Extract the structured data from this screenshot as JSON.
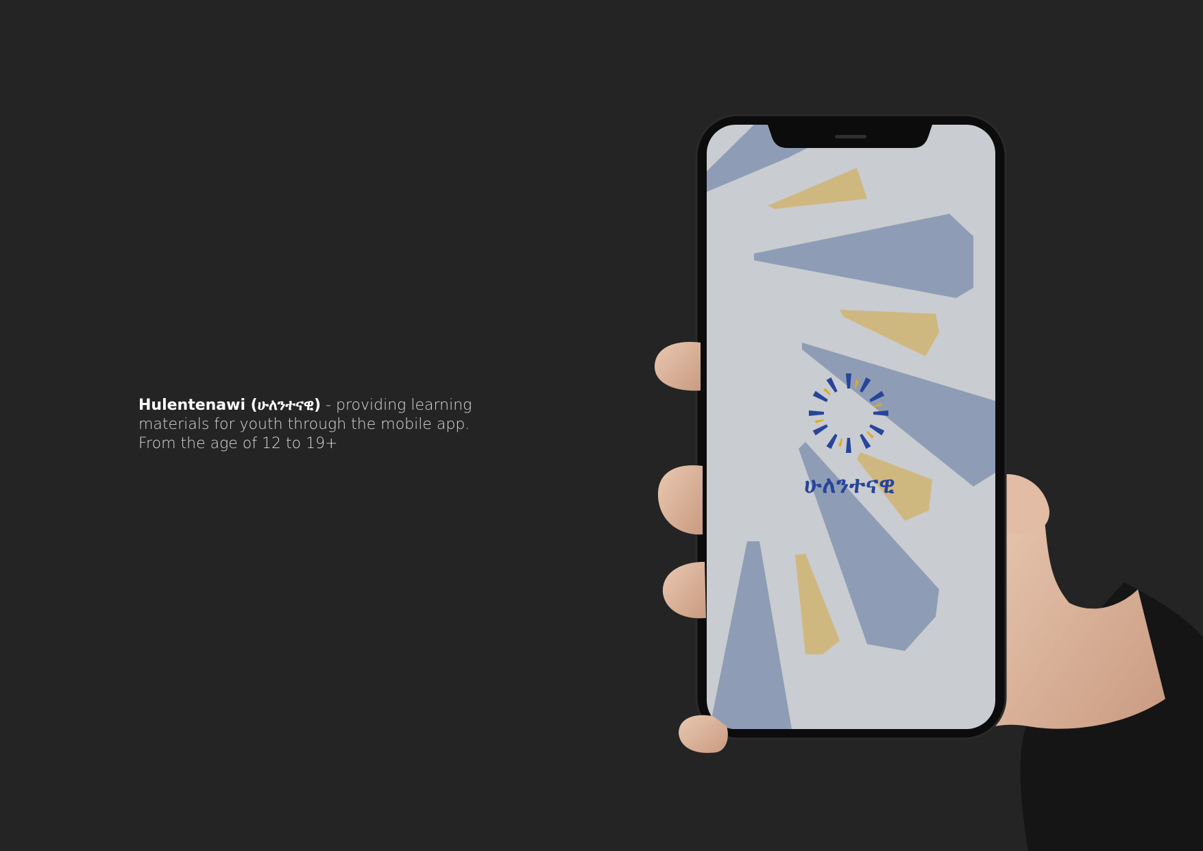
{
  "description": {
    "brand": "Hulentenawi (ሁለንተናዊ)",
    "text": " - providing learning materials for youth through the mobile app. From the age of 12 to 19+"
  },
  "app": {
    "logo_text": "ሁለንተናዊ"
  },
  "colors": {
    "background": "#242424",
    "screen": "#c9ccd0",
    "blue_shape": "#8e9db5",
    "gold_shape": "#cfb880",
    "logo_blue": "#28459a",
    "logo_gold": "#e0a92a"
  }
}
